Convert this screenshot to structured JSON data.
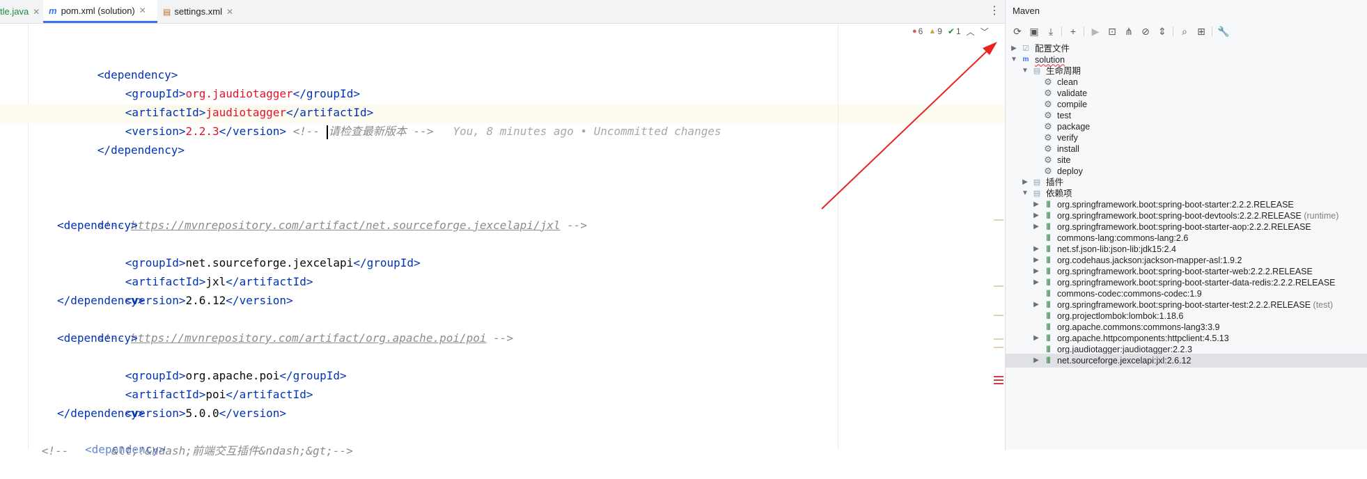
{
  "tabs": [
    {
      "label": "tle.java",
      "active": false
    },
    {
      "label": "pom.xml (solution)",
      "active": true,
      "icon": "m"
    },
    {
      "label": "settings.xml",
      "active": false
    }
  ],
  "inspections": {
    "errors": "6",
    "warnings": "9",
    "ok": "1"
  },
  "code": {
    "l1_open": "<dependency>",
    "l2_open": "<groupId>",
    "l2_val": "org.jaudiotagger",
    "l2_close": "</groupId>",
    "l3_open": "<artifactId>",
    "l3_val": "jaudiotagger",
    "l3_close": "</artifactId>",
    "l4_open": "<version>",
    "l4_val": "2.2.3",
    "l4_close": "</version>",
    "l4_comment_a": "<!-- ",
    "l4_comment_b": "请检查最新版本 -->",
    "l4_blame": "You, 8 minutes ago • Uncommitted changes",
    "l5_close": "</dependency>",
    "c1_pre": "<!-- ",
    "c1_url": "https://mvnrepository.com/artifact/net.sourceforge.jexcelapi/jxl",
    "c1_post": " -->",
    "d2_open": "<dependency>",
    "d2_g_open": "<groupId>",
    "d2_g_val": "net.sourceforge.jexcelapi",
    "d2_g_close": "</groupId>",
    "d2_a_open": "<artifactId>",
    "d2_a_val": "jxl",
    "d2_a_close": "</artifactId>",
    "d2_v_open": "<version>",
    "d2_v_val": "2.6.12",
    "d2_v_close": "</version>",
    "d2_close": "</dependency>",
    "c2_pre": "<!-- ",
    "c2_url": "https://mvnrepository.com/artifact/org.apache.poi/poi",
    "c2_post": " -->",
    "d3_open": "<dependency>",
    "d3_g_open": "<groupId>",
    "d3_g_val": "org.apache.poi",
    "d3_g_close": "</groupId>",
    "d3_a_open": "<artifactId>",
    "d3_a_val": "poi",
    "d3_a_close": "</artifactId>",
    "d3_v_open": "<version>",
    "d3_v_val": "5.0.0",
    "d3_v_close": "</version>",
    "d3_close": "</dependency>",
    "c3_a": "<!--",
    "c3_b": "&lt;!&ndash;前端交互插件&ndash;&gt;-->",
    "partial": "<dependency>"
  },
  "maven": {
    "title": "Maven",
    "tree": {
      "profiles": "配置文件",
      "project": "solution",
      "lifecycle": "生命周期",
      "phases": [
        "clean",
        "validate",
        "compile",
        "test",
        "package",
        "verify",
        "install",
        "site",
        "deploy"
      ],
      "plugins": "插件",
      "dependencies_label": "依赖项",
      "dependencies": [
        {
          "name": "org.springframework.boot:spring-boot-starter:2.2.2.RELEASE",
          "scope": "",
          "expandable": true
        },
        {
          "name": "org.springframework.boot:spring-boot-devtools:2.2.2.RELEASE",
          "scope": "(runtime)",
          "expandable": true
        },
        {
          "name": "org.springframework.boot:spring-boot-starter-aop:2.2.2.RELEASE",
          "scope": "",
          "expandable": true
        },
        {
          "name": "commons-lang:commons-lang:2.6",
          "scope": "",
          "expandable": false
        },
        {
          "name": "net.sf.json-lib:json-lib:jdk15:2.4",
          "scope": "",
          "expandable": true
        },
        {
          "name": "org.codehaus.jackson:jackson-mapper-asl:1.9.2",
          "scope": "",
          "expandable": true
        },
        {
          "name": "org.springframework.boot:spring-boot-starter-web:2.2.2.RELEASE",
          "scope": "",
          "expandable": true
        },
        {
          "name": "org.springframework.boot:spring-boot-starter-data-redis:2.2.2.RELEASE",
          "scope": "",
          "expandable": true
        },
        {
          "name": "commons-codec:commons-codec:1.9",
          "scope": "",
          "expandable": false
        },
        {
          "name": "org.springframework.boot:spring-boot-starter-test:2.2.2.RELEASE",
          "scope": "(test)",
          "expandable": true
        },
        {
          "name": "org.projectlombok:lombok:1.18.6",
          "scope": "",
          "expandable": false
        },
        {
          "name": "org.apache.commons:commons-lang3:3.9",
          "scope": "",
          "expandable": false
        },
        {
          "name": "org.apache.httpcomponents:httpclient:4.5.13",
          "scope": "",
          "expandable": true
        },
        {
          "name": "org.jaudiotagger:jaudiotagger:2.2.3",
          "scope": "",
          "expandable": false
        },
        {
          "name": "net.sourceforge.jexcelapi:jxl:2.6.12",
          "scope": "",
          "expandable": true,
          "selected": true
        }
      ]
    }
  },
  "colors": {
    "accent": "#3574f0",
    "arrow": "#e8231f",
    "tag": "#0033b3",
    "package": "#e0132c"
  }
}
